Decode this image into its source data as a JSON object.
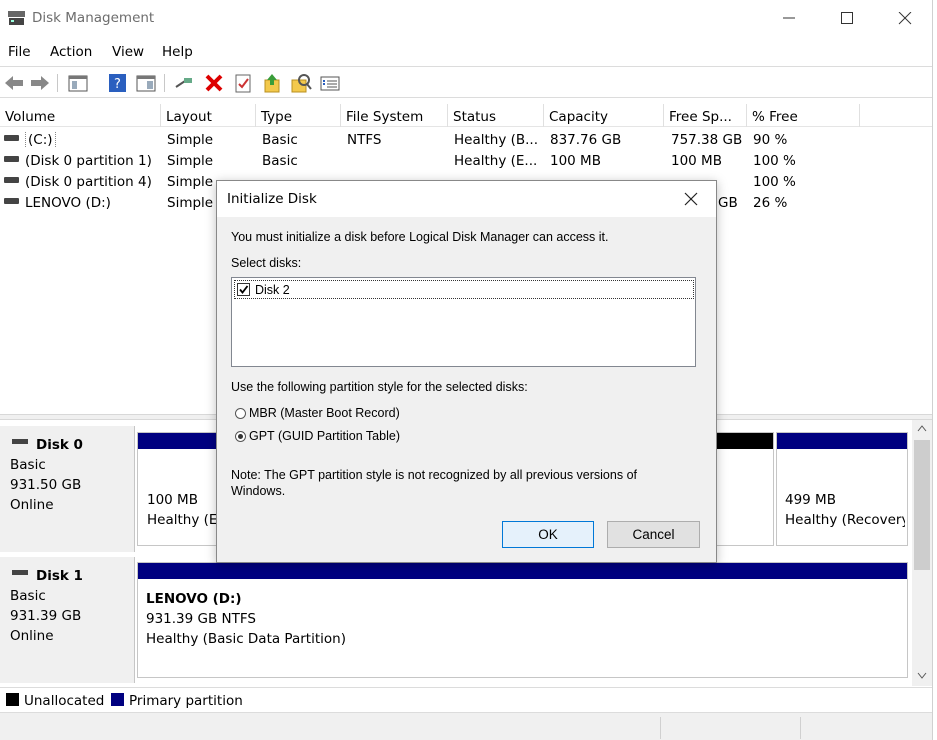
{
  "window": {
    "title": "Disk Management",
    "icon": "disk-management-icon"
  },
  "menu": [
    "File",
    "Action",
    "View",
    "Help"
  ],
  "toolbar": {
    "icons": [
      "back-arrow-icon",
      "forward-arrow-icon",
      "console-tree-icon",
      "help-icon",
      "action-pane-icon",
      "connect-icon",
      "delete-icon",
      "properties-icon",
      "export-icon",
      "find-icon",
      "list-icon"
    ]
  },
  "volume_table": {
    "headers": [
      "Volume",
      "Layout",
      "Type",
      "File System",
      "Status",
      "Capacity",
      "Free Sp...",
      "% Free"
    ],
    "rows": [
      {
        "volume": "(C:)",
        "layout": "Simple",
        "type": "Basic",
        "fs": "NTFS",
        "status": "Healthy (B...",
        "capacity": "837.76 GB",
        "free": "757.38 GB",
        "pct": "90 %"
      },
      {
        "volume": "(Disk 0 partition 1)",
        "layout": "Simple",
        "type": "Basic",
        "fs": "",
        "status": "Healthy (E...",
        "capacity": "100 MB",
        "free": "100 MB",
        "pct": "100 %"
      },
      {
        "volume": "(Disk 0 partition 4)",
        "layout": "Simple",
        "type": "",
        "fs": "",
        "status": "",
        "capacity": "",
        "free": "",
        "pct": "100 %"
      },
      {
        "volume": "LENOVO (D:)",
        "layout": "Simple",
        "type": "",
        "fs": "",
        "status": "",
        "capacity": "",
        "free": "GB",
        "pct": "26 %"
      }
    ]
  },
  "disks": [
    {
      "name": "Disk 0",
      "kind": "Basic",
      "size": "931.50 GB",
      "state": "Online",
      "partitions": [
        {
          "size": "100 MB",
          "status": "Healthy (EFI System Partition)"
        },
        {
          "size": "499 MB",
          "status": "Healthy (Recovery Partition)"
        }
      ]
    },
    {
      "name": "Disk 1",
      "kind": "Basic",
      "size": "931.39 GB",
      "state": "Online",
      "partitions": [
        {
          "name": "LENOVO  (D:)",
          "size": "931.39 GB NTFS",
          "status": "Healthy (Basic Data Partition)"
        }
      ]
    }
  ],
  "legend": [
    {
      "label": "Unallocated",
      "color": "#000000"
    },
    {
      "label": "Primary partition",
      "color": "#000080"
    }
  ],
  "colors": {
    "primary": "#000080",
    "unallocated": "#000000",
    "accent": "#0078d7"
  },
  "dialog": {
    "title": "Initialize Disk",
    "intro": "You must initialize a disk before Logical Disk Manager can access it.",
    "select_label": "Select disks:",
    "disks": [
      {
        "label": "Disk 2",
        "checked": true
      }
    ],
    "style_label": "Use the following partition style for the selected disks:",
    "options": [
      {
        "label": "MBR (Master Boot Record)",
        "selected": false
      },
      {
        "label": "GPT (GUID Partition Table)",
        "selected": true
      }
    ],
    "note": "Note: The GPT partition style is not recognized by all previous versions of Windows.",
    "ok": "OK",
    "cancel": "Cancel"
  }
}
